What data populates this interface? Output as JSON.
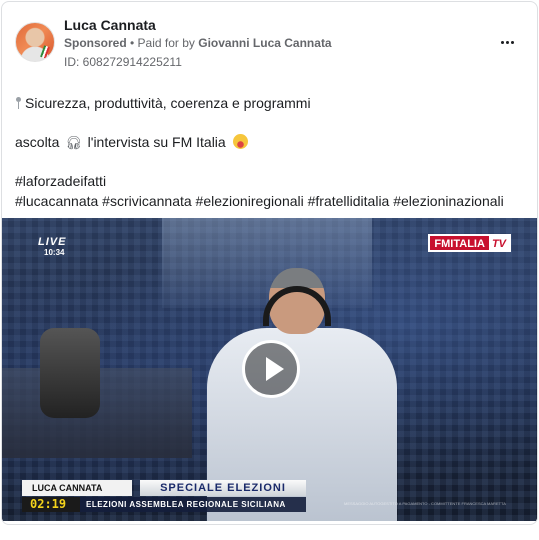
{
  "post": {
    "page_name": "Luca Cannata",
    "sponsored_label": "Sponsored",
    "separator": " • ",
    "paid_for_prefix": "Paid for by ",
    "payer": "Giovanni Luca Cannata",
    "ad_id": "ID: 608272914225211"
  },
  "text": {
    "line1": "Sicurezza, produttività, coerenza e programmi",
    "line2_before": "ascolta",
    "line2_after": "l'intervista su FM Italia",
    "hashtags_line1": "#laforzadeifatti",
    "hashtags_line2": "#lucacannata #scrivicannata #elezioniregionali #fratelliditalia #elezioninazionali"
  },
  "video": {
    "live_label": "LIVE",
    "live_time": "10:34",
    "channel_fm": "FMITALIA",
    "channel_tv": "TV",
    "lower_third_name": "LUCA CANNATA",
    "lower_third_title": "SPECIALE ELEZIONI",
    "clock": "02:19",
    "subtitle": "ELEZIONI ASSEMBLEA REGIONALE SICILIANA",
    "disclaimer": "MESSAGGIO AUTOGESTITO A PAGAMENTO - COMMITTENTE FRANCESCA MARETTA"
  },
  "icons": {
    "pin": "pushpin-icon",
    "headphones": "headphones-icon",
    "emoji": "grinning-face-icon",
    "more": "more-options-icon",
    "play": "play-icon"
  }
}
